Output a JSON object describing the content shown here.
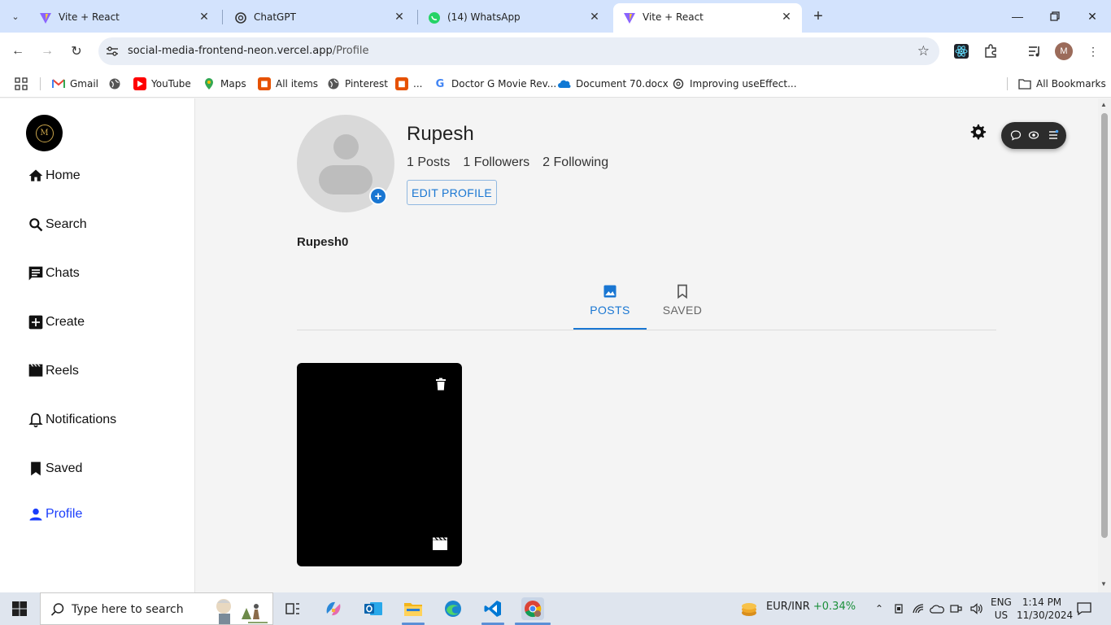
{
  "browser": {
    "tabs": [
      {
        "title": "Vite + React",
        "active": false
      },
      {
        "title": "ChatGPT",
        "active": false
      },
      {
        "title": "(14) WhatsApp",
        "active": false
      },
      {
        "title": "Vite + React",
        "active": true
      }
    ],
    "url_host": "social-media-frontend-neon.vercel.app",
    "url_path": "/Profile",
    "profile_initial": "M",
    "bookmarks": [
      "Gmail",
      "YouTube",
      "Maps",
      "All items",
      "Pinterest",
      "...",
      "Doctor G Movie Rev...",
      "Document 70.docx",
      "Improving useEffect..."
    ],
    "all_bookmarks_label": "All Bookmarks"
  },
  "sidebar": {
    "logo_text": "M",
    "items": [
      {
        "label": "Home",
        "icon": "home-icon"
      },
      {
        "label": "Search",
        "icon": "search-icon"
      },
      {
        "label": "Chats",
        "icon": "chat-icon"
      },
      {
        "label": "Create",
        "icon": "add-box-icon"
      },
      {
        "label": "Reels",
        "icon": "movie-icon"
      },
      {
        "label": "Notifications",
        "icon": "bell-icon"
      },
      {
        "label": "Saved",
        "icon": "bookmark-icon"
      },
      {
        "label": "Profile",
        "icon": "person-icon",
        "active": true
      }
    ],
    "active_color": "#1a3dfc"
  },
  "profile": {
    "name": "Rupesh",
    "posts": "1 Posts",
    "followers": "1 Followers",
    "following": "2 Following",
    "edit_label": "EDIT PROFILE",
    "handle": "Rupesh0",
    "tabs": [
      {
        "label": "POSTS",
        "icon": "image-icon",
        "active": true
      },
      {
        "label": "SAVED",
        "icon": "bookmark-outline-icon",
        "active": false
      }
    ],
    "accent": "#1976d2"
  },
  "taskbar": {
    "search_placeholder": "Type here to search",
    "ticker_pair": "EUR/INR",
    "ticker_change": "+0.34%",
    "lang_line1": "ENG",
    "lang_line2": "US",
    "time": "1:14 PM",
    "date": "11/30/2024"
  }
}
